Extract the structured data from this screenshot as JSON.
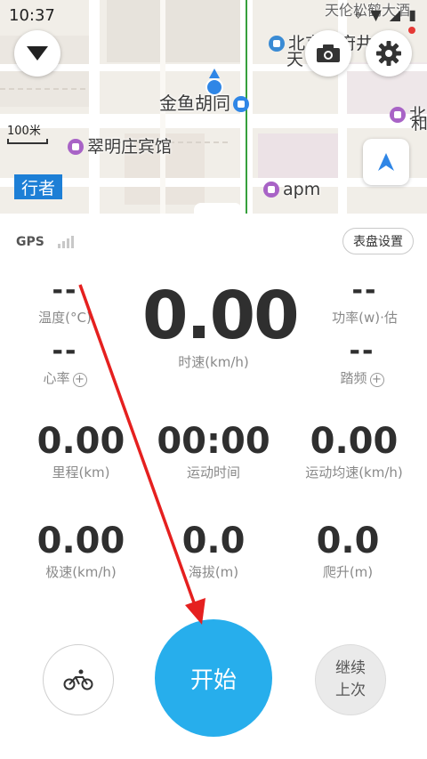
{
  "status_bar": {
    "time": "10:37"
  },
  "map": {
    "labels": {
      "jinyu_hutong": "金鱼胡同",
      "cuiming": "翠明庄宾馆",
      "apm": "apm",
      "beijing_top": "北京三府井",
      "tian": "天",
      "scale": "100米",
      "logo": "行者",
      "xiao_bei": "北",
      "xiao_he": "和",
      "top_right": "天伦松鹤大酒"
    }
  },
  "panel": {
    "gps_label": "GPS",
    "dial_settings": "表盘设置",
    "metrics": {
      "temperature": {
        "value": "--",
        "label": "温度(°C)"
      },
      "speed": {
        "value": "0.00",
        "label": "时速(km/h)"
      },
      "power": {
        "value": "--",
        "label": "功率(w)·估"
      },
      "heart_rate": {
        "value": "--",
        "label": "心率"
      },
      "cadence": {
        "value": "--",
        "label": "踏频"
      },
      "distance": {
        "value": "0.00",
        "label": "里程(km)"
      },
      "duration": {
        "value": "00:00",
        "label": "运动时间"
      },
      "avg_speed": {
        "value": "0.00",
        "label": "运动均速(km/h)"
      },
      "max_speed": {
        "value": "0.00",
        "label": "极速(km/h)"
      },
      "altitude": {
        "value": "0.0",
        "label": "海拔(m)"
      },
      "climb": {
        "value": "0.0",
        "label": "爬升(m)"
      }
    },
    "plus_symbol": "+"
  },
  "actions": {
    "start": "开始",
    "continue_line1": "继续",
    "continue_line2": "上次"
  },
  "colors": {
    "accent": "#27aeec",
    "annotation_arrow": "#e5201f",
    "metro_line": "#36a03c"
  }
}
